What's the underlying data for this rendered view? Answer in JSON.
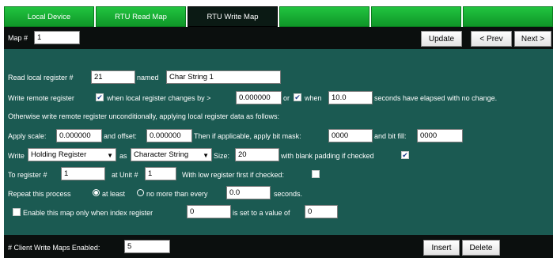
{
  "tabs": [
    {
      "label": "Local Device",
      "active": false
    },
    {
      "label": "RTU Read Map",
      "active": false
    },
    {
      "label": "RTU Write Map",
      "active": true
    },
    {
      "label": "",
      "active": false
    },
    {
      "label": "",
      "active": false
    },
    {
      "label": "",
      "active": false
    }
  ],
  "header": {
    "map_label": "Map #",
    "map_value": "1",
    "update_label": "Update",
    "prev_label": "< Prev",
    "next_label": "Next >"
  },
  "form": {
    "read_local_label": "Read local register #",
    "read_local_value": "21",
    "named_label": "named",
    "named_value": "Char String 1",
    "write_remote_label": "Write remote register",
    "when_changes_label": "when local register changes by >",
    "change_value": "0.000000",
    "or_label": "or",
    "when_label": "when",
    "seconds_value": "10.0",
    "seconds_elapsed_label": "seconds have elapsed with no change.",
    "otherwise_text": "Otherwise write remote register unconditionally, applying local register data as follows:",
    "apply_scale_label": "Apply scale:",
    "scale_value": "0.000000",
    "offset_label": "and offset:",
    "offset_value": "0.000000",
    "bitmask_label": "Then if applicable, apply bit mask:",
    "bitmask_value": "0000",
    "bitfill_label": "and bit fill:",
    "bitfill_value": "0000",
    "write_label": "Write",
    "register_type": "Holding Register",
    "as_label": "as",
    "data_type": "Character String",
    "size_label": "Size:",
    "size_value": "20",
    "padding_label": "with blank padding if checked",
    "to_register_label": "To register #",
    "to_register_value": "1",
    "at_unit_label": "at Unit #",
    "unit_value": "1",
    "low_first_label": "With low register first if checked:",
    "repeat_label": "Repeat this process",
    "at_least_label": "at least",
    "no_more_label": "no more than every",
    "repeat_seconds_value": "0.0",
    "repeat_seconds_label": "seconds.",
    "enable_label": "Enable this map only when index register",
    "index_value": "0",
    "set_value_label": "is set to a value of",
    "set_value": "0"
  },
  "footer": {
    "count_label": "# Client Write Maps Enabled:",
    "count_value": "5",
    "insert_label": "Insert",
    "delete_label": "Delete"
  },
  "checkboxes": {
    "write_on_change": true,
    "write_on_time": true,
    "blank_padding": true,
    "low_first": false,
    "enable_map": false
  },
  "radios": {
    "at_least": true,
    "no_more_than": false
  },
  "colors": {
    "tab_green": "#1ab83a",
    "panel": "#1b5a52",
    "bar": "#0b0f0e"
  }
}
